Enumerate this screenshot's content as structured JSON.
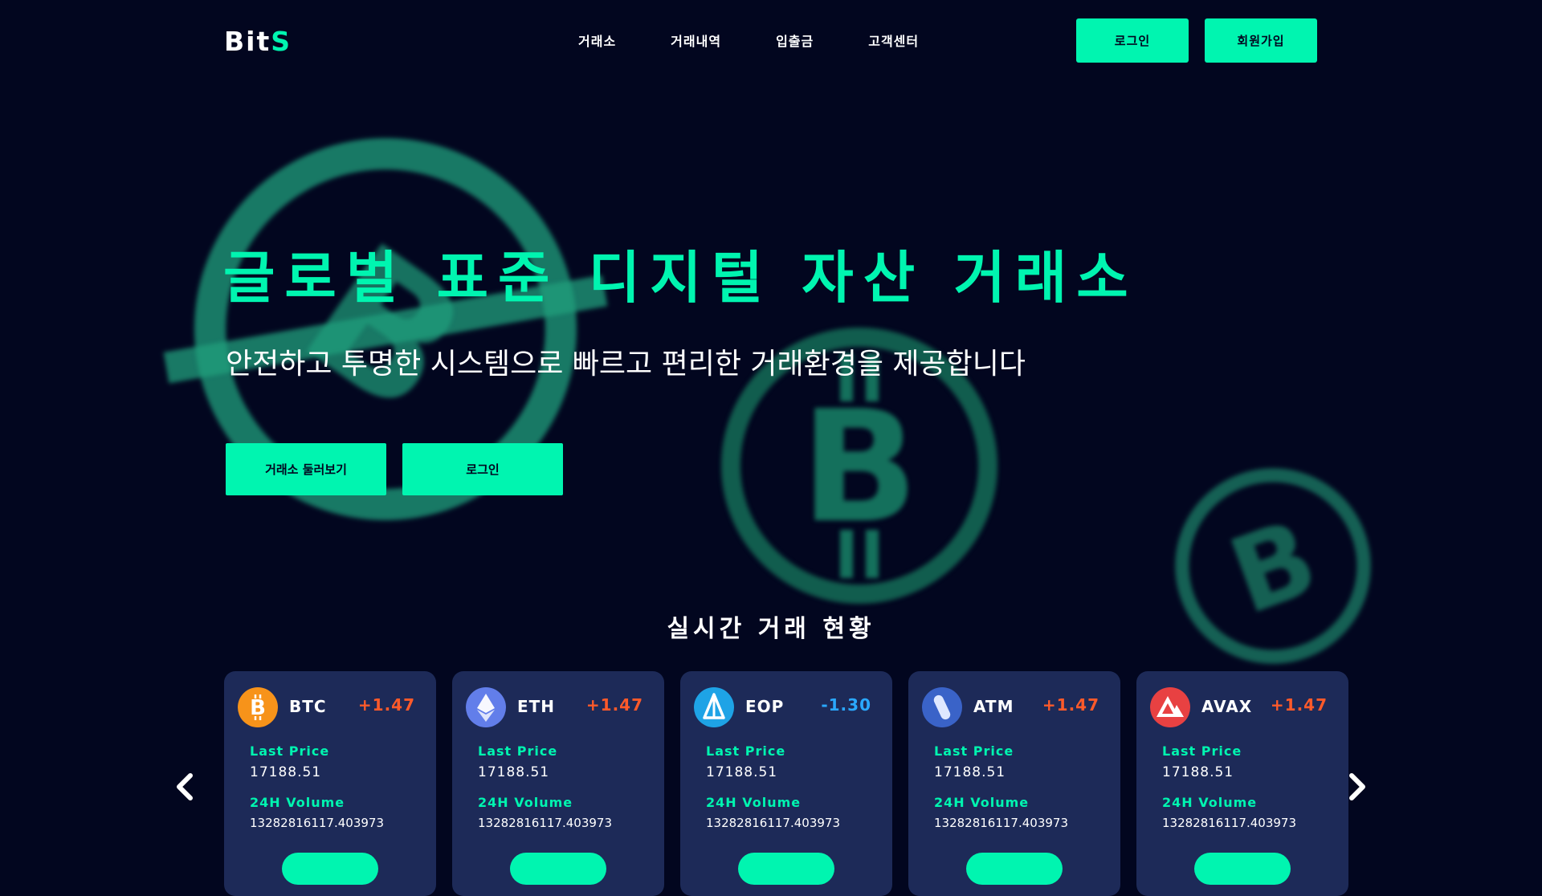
{
  "header": {
    "logo_main": "Bit",
    "logo_accent": "S",
    "nav": [
      "거래소",
      "거래내역",
      "입출금",
      "고객센터"
    ],
    "login_label": "로그인",
    "signup_label": "회원가입"
  },
  "hero": {
    "title": "글로벌 표준 디지털 자산 거래소",
    "subtitle": "안전하고 투명한 시스템으로 빠르고 편리한 거래환경을 제공합니다",
    "explore_label": "거래소 둘러보기",
    "login_label": "로그인"
  },
  "live": {
    "title": "실시간 거래 현황",
    "cards": [
      {
        "symbol": "BTC",
        "change": "+1.47",
        "price_label": "Last Price",
        "price": "17188.51",
        "volume_label": "24H Volume",
        "volume": "13282816117.403973",
        "icon": "bitcoin-icon"
      },
      {
        "symbol": "ETH",
        "change": "+1.47",
        "price_label": "Last Price",
        "price": "17188.51",
        "volume_label": "24H Volume",
        "volume": "13282816117.403973",
        "icon": "ethereum-icon"
      },
      {
        "symbol": "EOP",
        "change": "-1.30",
        "price_label": "Last Price",
        "price": "17188.51",
        "volume_label": "24H Volume",
        "volume": "13282816117.403973",
        "icon": "eop-icon"
      },
      {
        "symbol": "ATM",
        "change": "+1.47",
        "price_label": "Last Price",
        "price": "17188.51",
        "volume_label": "24H Volume",
        "volume": "13282816117.403973",
        "icon": "atm-icon"
      },
      {
        "symbol": "AVAX",
        "change": "+1.47",
        "price_label": "Last Price",
        "price": "17188.51",
        "volume_label": "24H Volume",
        "volume": "13282816117.403973",
        "icon": "avax-icon"
      }
    ]
  },
  "colors": {
    "accent": "#00f5b0",
    "background": "#02061f",
    "card": "#1d2a58",
    "positive": "#ff5a2a",
    "negative": "#2aa8ff"
  }
}
